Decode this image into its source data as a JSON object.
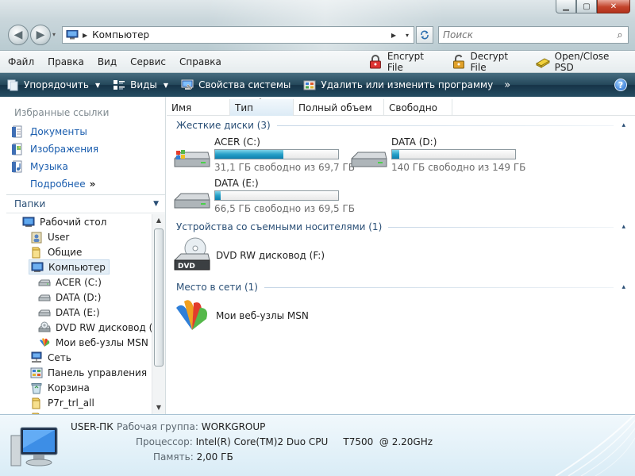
{
  "window": {
    "minimize_glyph": "▁",
    "maximize_glyph": "▢",
    "close_glyph": "✕"
  },
  "nav": {
    "back_glyph": "◀",
    "forward_glyph": "▶",
    "dropdown_glyph": "▾"
  },
  "address": {
    "separator": "▶",
    "path": "Компьютер",
    "trail_separator": "▶",
    "dropdown_glyph": "▾"
  },
  "search": {
    "placeholder": "Поиск",
    "icon_glyph": "⌕"
  },
  "menu": {
    "file": "Файл",
    "edit": "Правка",
    "view": "Вид",
    "tools": "Сервис",
    "help": "Справка",
    "encrypt": "Encrypt File",
    "decrypt": "Decrypt File",
    "openclose": "Open/Close PSD"
  },
  "toolbar": {
    "organize": "Упорядочить",
    "views": "Виды",
    "system_properties": "Свойства системы",
    "uninstall": "Удалить или изменить программу",
    "more": "»",
    "help": "?"
  },
  "favorites": {
    "title": "Избранные ссылки",
    "items": [
      "Документы",
      "Изображения",
      "Музыка"
    ],
    "more": "Подробнее",
    "more_chev": "»"
  },
  "folders": {
    "title": "Папки",
    "chev": "⌄"
  },
  "tree": [
    {
      "label": "Рабочий стол",
      "icon": "desktop-icon"
    },
    {
      "label": "User",
      "icon": "user-folder-icon"
    },
    {
      "label": "Общие",
      "icon": "folder-icon"
    },
    {
      "label": "Компьютер",
      "icon": "computer-icon"
    },
    {
      "label": "ACER (C:)",
      "icon": "drive-icon"
    },
    {
      "label": "DATA (D:)",
      "icon": "drive-icon"
    },
    {
      "label": "DATA (E:)",
      "icon": "drive-icon"
    },
    {
      "label": "DVD RW дисковод (F:)",
      "icon": "dvd-drive-icon"
    },
    {
      "label": "Мои веб-узлы MSN",
      "icon": "msn-icon"
    },
    {
      "label": "Сеть",
      "icon": "network-icon"
    },
    {
      "label": "Панель управления",
      "icon": "control-panel-icon"
    },
    {
      "label": "Корзина",
      "icon": "recycle-bin-icon"
    },
    {
      "label": "P7r_trl_all",
      "icon": "folder-icon"
    }
  ],
  "columns": {
    "name": "Имя",
    "type": "Тип",
    "total": "Полный объем",
    "free": "Свободно",
    "sort_glyph": "ˆ"
  },
  "groups": {
    "hard_disks": "Жесткие диски (3)",
    "removable": "Устройства со съемными носителями (1)",
    "network": "Место в сети (1)",
    "collapse_glyph": "▴"
  },
  "drives": [
    {
      "name": "ACER (C:)",
      "free_text": "31,1 ГБ свободно из 69,7 ГБ",
      "used_fraction": 0.554
    },
    {
      "name": "DATA (D:)",
      "free_text": "140 ГБ свободно из 149 ГБ",
      "used_fraction": 0.06
    },
    {
      "name": "DATA (E:)",
      "free_text": "66,5 ГБ свободно из 69,5 ГБ",
      "used_fraction": 0.043
    }
  ],
  "removable": {
    "name": "DVD RW дисковод (F:)",
    "badge": "DVD"
  },
  "network_loc": {
    "name": "Мои веб-узлы MSN"
  },
  "details": {
    "computer_name": "USER-ПК",
    "workgroup_label": "Рабочая группа:",
    "workgroup_value": "WORKGROUP",
    "cpu_label": "Процессор:",
    "cpu_value": "Intel(R) Core(TM)2 Duo CPU     T7500  @ 2.20GHz",
    "memory_label": "Память:",
    "memory_value": "2,00 ГБ"
  },
  "colors": {
    "accent": "#1a5dae",
    "toolbar": "#23475a",
    "bar_fill": "#26a0c8"
  }
}
